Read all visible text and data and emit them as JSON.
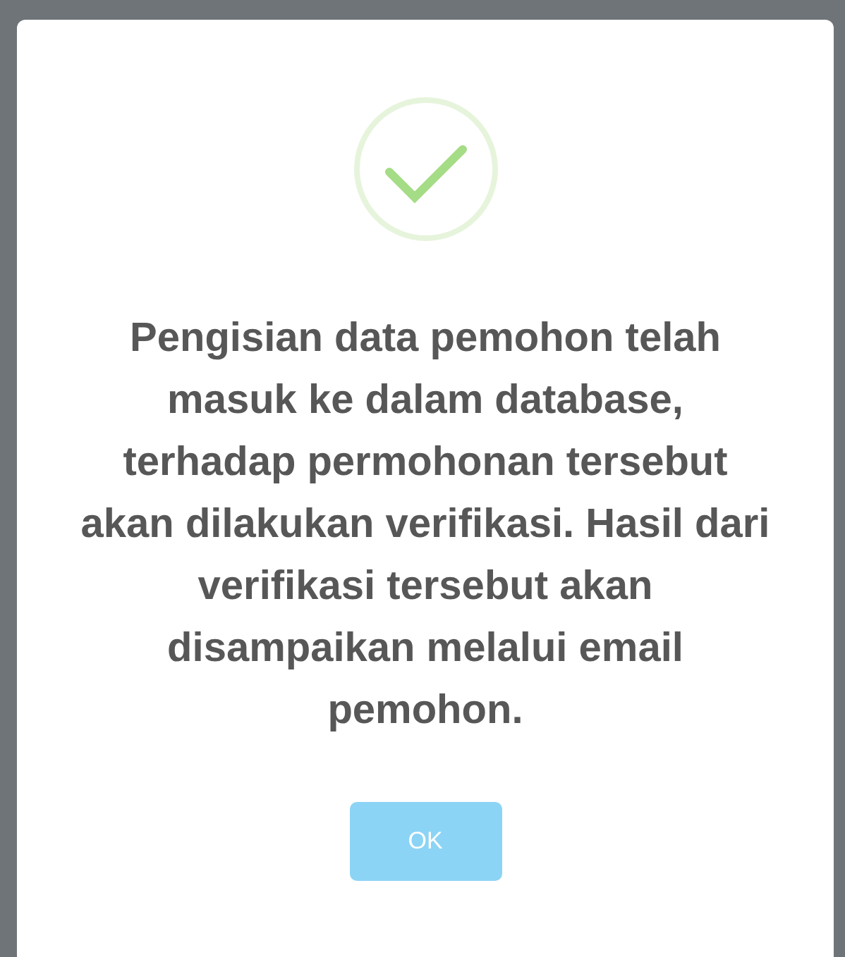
{
  "dialog": {
    "message": "Pengisian data pemohon telah masuk ke dalam database, terhadap permohonan tersebut akan dilakukan verifikasi. Hasil dari verifikasi tersebut akan disampaikan melalui email pemohon.",
    "buttons": [
      {
        "label": "OK"
      }
    ]
  }
}
